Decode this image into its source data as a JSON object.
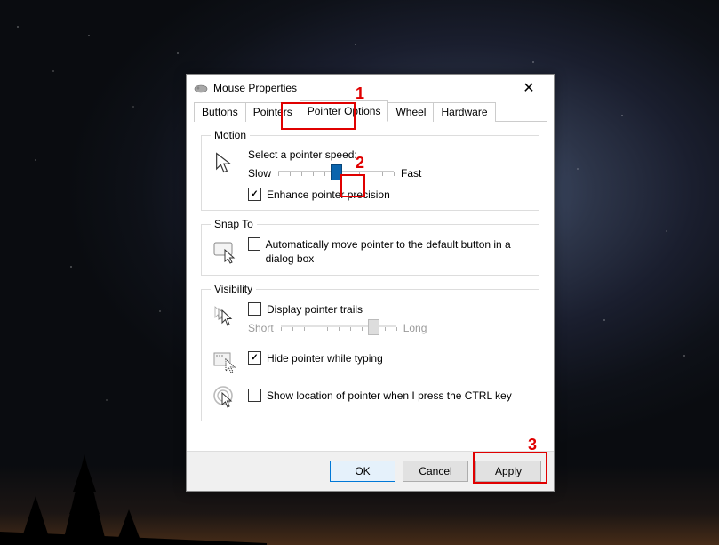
{
  "window": {
    "title": "Mouse Properties"
  },
  "tabs": [
    "Buttons",
    "Pointers",
    "Pointer Options",
    "Wheel",
    "Hardware"
  ],
  "active_tab_index": 2,
  "motion": {
    "legend": "Motion",
    "label": "Select a pointer speed:",
    "slow": "Slow",
    "fast": "Fast",
    "speed_value": 6,
    "speed_max": 11,
    "enhance_checked": true,
    "enhance_label": "Enhance pointer precision"
  },
  "snapto": {
    "legend": "Snap To",
    "checked": false,
    "label": "Automatically move pointer to the default button in a dialog box"
  },
  "visibility": {
    "legend": "Visibility",
    "trails_checked": false,
    "trails_label": "Display pointer trails",
    "short": "Short",
    "long": "Long",
    "trails_value": 9,
    "trails_max": 11,
    "hide_checked": true,
    "hide_label": "Hide pointer while typing",
    "ctrl_checked": false,
    "ctrl_label": "Show location of pointer when I press the CTRL key"
  },
  "buttons": {
    "ok": "OK",
    "cancel": "Cancel",
    "apply": "Apply"
  },
  "annotations": {
    "n1": "1",
    "n2": "2",
    "n3": "3"
  }
}
